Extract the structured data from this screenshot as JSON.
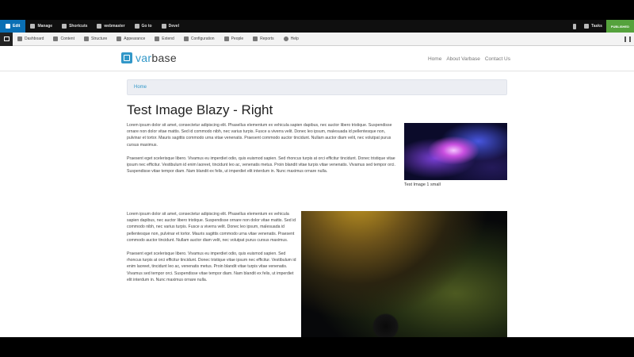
{
  "toolbar": {
    "edit": "Edit",
    "manage": "Manage",
    "shortcuts": "Shortcuts",
    "user": "webmaster",
    "goto": "Go to",
    "devel": "Devel",
    "tasks": "Tasks",
    "status": "PUBLISHED"
  },
  "admin_menu": [
    "Dashboard",
    "Content",
    "Structure",
    "Appearance",
    "Extend",
    "Configuration",
    "People",
    "Reports",
    "Help"
  ],
  "site": {
    "logo_prefix": "var",
    "logo_suffix": "base",
    "nav": [
      "Home",
      "About Varbase",
      "Contact Us"
    ]
  },
  "breadcrumb": "Home",
  "page_title": "Test Image Blazy - Right",
  "paragraphs": {
    "lorem_a": "Lorem ipsum dolor sit amet, consectetur adipiscing elit. Phasellus elementum ex vehicula sapien dapibus, nec auctor libero tristique. Suspendisse ornare non dolor vitae mattis. Sed id commodo nibh, nec varius turpis. Fusce a viverra velit. Donec leo ipsum, malesuada id pellentesque non, pulvinar et tortor. Mauris sagittis commodo urna vitae venenatis. Praesent commodo auctor tincidunt. Nullam auctor diam velit, nec volutpat purus cursus maximus.",
    "praesent_a": "Praesent eget scelerisque libero. Vivamus eu imperdiet odio, quis euismod sapien. Sed rhoncus turpis at orci efficitur tincidunt. Donec tristique vitae ipsum nec efficitur. Vestibulum id enim laoreet, tincidunt leo ac, venenatis metus. Proin blandit vitae turpis vitae venenatis. Vivamus sed tempor orci. Suspendisse vitae tempor diam. Nam blandit ex felis, ut imperdiet elit interdum in. Nunc maximus ornare nulla.",
    "lorem_b": "Lorem ipsum dolor sit amet, consectetur adipiscing elit. Phasellus elementum ex vehicula sapien dapibus, nec auctor libero tristique. Suspendisse ornare non dolor vitae mattis. Sed id commodo nibh, nec varius turpis. Fusce a viverra velit. Donec leo ipsum, malesuada id pellentesque non, pulvinar et tortor. Mauris sagittis commodo urna vitae venenatis. Praesent commodo auctor tincidunt. Nullam auctor diam velit, nec volutpat purus cursus maximus.",
    "praesent_b": "Praesent eget scelerisque libero. Vivamus eu imperdiet odio, quis euismod sapien. Sed rhoncus turpis at orci efficitur tincidunt. Donec tristique vitae ipsum nec efficitur. Vestibulum id enim laoreet, tincidunt leo ac, venenatis metus. Proin blandit vitae turpis vitae venenatis. Vivamus sed tempor orci. Suspendisse vitae tempor diam. Nam blandit ex felis, ut imperdiet elit interdum in. Nunc maximus ornare nulla."
  },
  "image_small_caption": "Test Image 1 small",
  "icons": {
    "edit": "pencil-icon",
    "manage": "menu-icon",
    "shortcuts": "star-icon",
    "user": "user-icon",
    "goto": "compass-icon",
    "devel": "gear-icon",
    "tasks": "tasks-icon",
    "device": "phone-icon"
  },
  "colors": {
    "primary": "#3197c8",
    "published": "#55a23c",
    "edit_active": "#0a6fb4"
  }
}
